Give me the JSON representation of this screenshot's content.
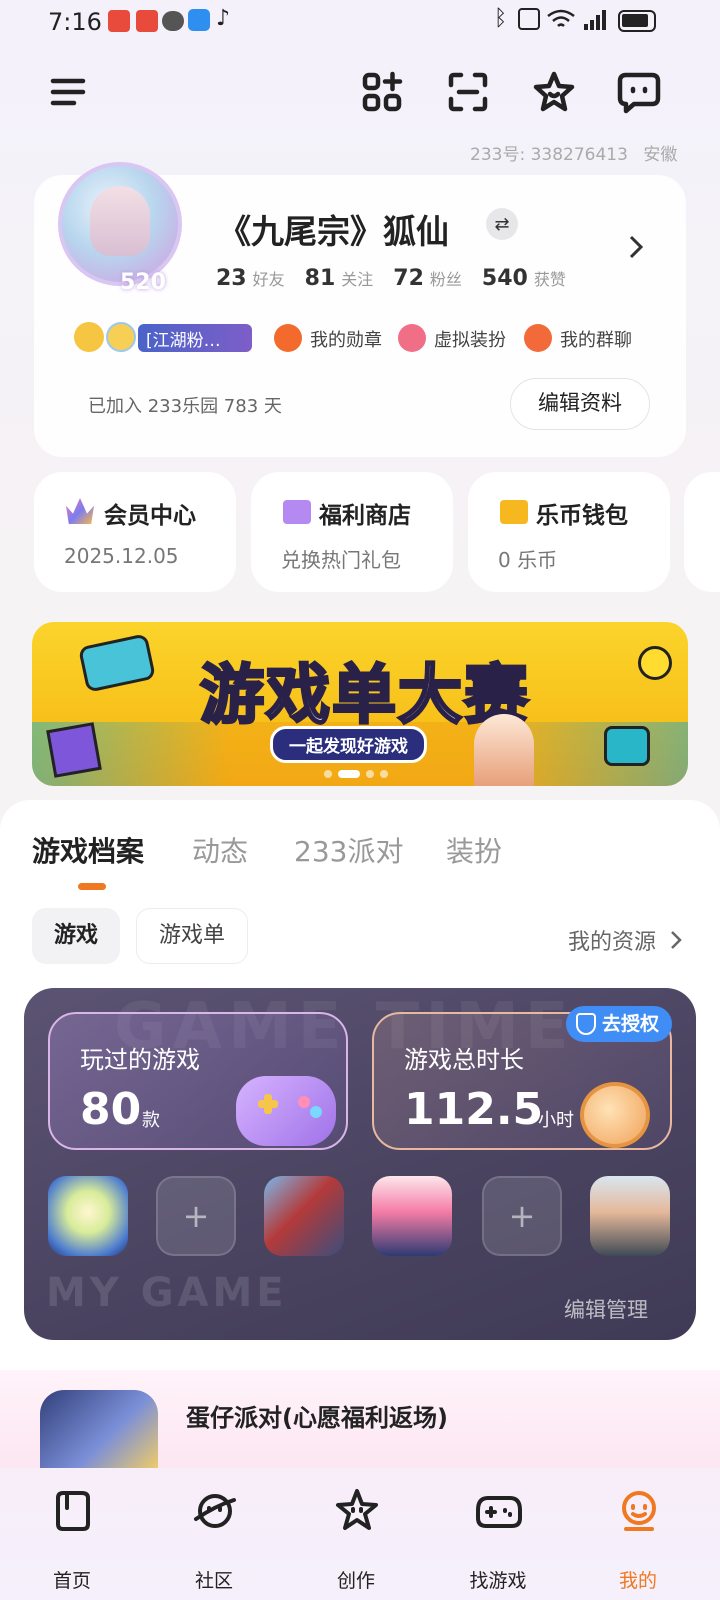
{
  "status": {
    "time": "7:16",
    "battery": "88"
  },
  "account": {
    "id_label": "233号:",
    "id_value": "338276413",
    "region": "安徽"
  },
  "profile": {
    "name": "《九尾宗》狐仙",
    "avatar_badge": "520",
    "stats": [
      {
        "value": "23",
        "label": "好友"
      },
      {
        "value": "81",
        "label": "关注"
      },
      {
        "value": "72",
        "label": "粉丝"
      },
      {
        "value": "540",
        "label": "获赞"
      }
    ],
    "tag": "[江湖粉…",
    "links": [
      {
        "label": "我的勋章"
      },
      {
        "label": "虚拟装扮"
      },
      {
        "label": "我的群聊"
      }
    ],
    "joined": "已加入 233乐园 783 天",
    "edit_label": "编辑资料"
  },
  "quick": [
    {
      "title": "会员中心",
      "sub": "2025.12.05"
    },
    {
      "title": "福利商店",
      "sub": "兑换热门礼包"
    },
    {
      "title": "乐币钱包",
      "sub": "0 乐币"
    }
  ],
  "banner": {
    "title": "游戏单大赛",
    "subtitle": "一起发现好游戏"
  },
  "tabs": [
    "游戏档案",
    "动态",
    "233派对",
    "装扮"
  ],
  "subtabs": [
    "游戏",
    "游戏单"
  ],
  "resources_label": "我的资源",
  "archive": {
    "bg_text_top": "GAME TIME",
    "played_label": "玩过的游戏",
    "played_value": "80",
    "played_unit": "款",
    "duration_label": "游戏总时长",
    "duration_value": "112.5",
    "duration_unit": "小时",
    "auth_label": "去授权",
    "bg_text_bottom": "MY GAME",
    "manage_label": "编辑管理"
  },
  "peek_game": {
    "title": "蛋仔派对(心愿福利返场)"
  },
  "nav": [
    "首页",
    "社区",
    "创作",
    "找游戏",
    "我的"
  ],
  "colors": {
    "accent": "#f07820",
    "card_dark": "#4f4863"
  }
}
